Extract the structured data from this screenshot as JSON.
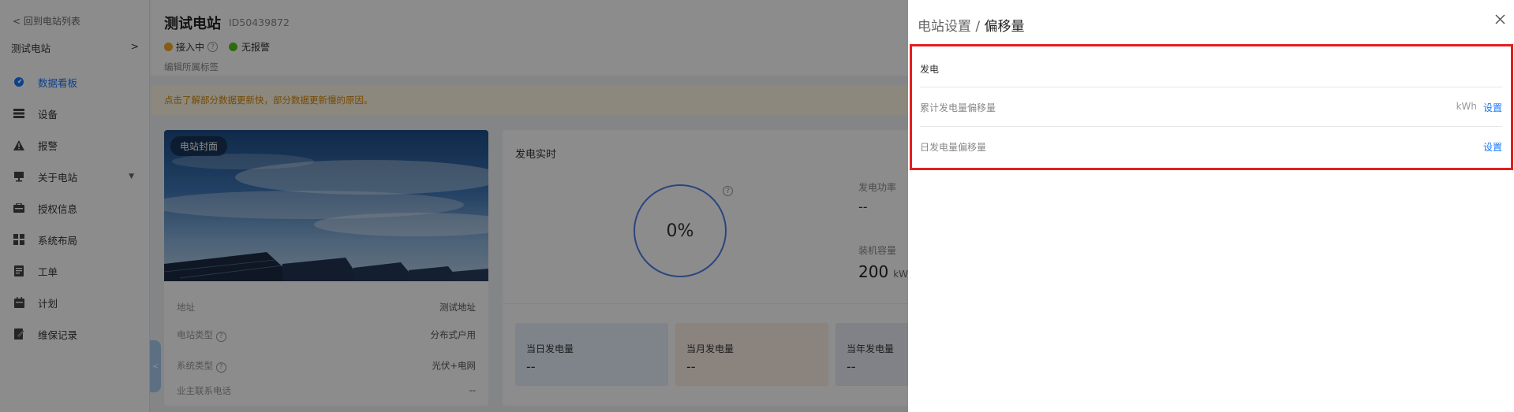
{
  "sidebar": {
    "back_label": "回到电站列表",
    "station_name": "测试电站",
    "items": [
      {
        "label": "数据看板",
        "icon": "dashboard-icon"
      },
      {
        "label": "设备",
        "icon": "device-icon"
      },
      {
        "label": "报警",
        "icon": "alarm-icon"
      },
      {
        "label": "关于电站",
        "icon": "station-info-icon"
      },
      {
        "label": "授权信息",
        "icon": "authorization-icon"
      },
      {
        "label": "系统布局",
        "icon": "layout-icon"
      },
      {
        "label": "工单",
        "icon": "work-order-icon"
      },
      {
        "label": "计划",
        "icon": "plan-icon"
      },
      {
        "label": "维保记录",
        "icon": "maintenance-icon"
      }
    ]
  },
  "header": {
    "title": "测试电站",
    "station_id": "ID50439872",
    "status_access": "接入中",
    "status_alarm": "无报警",
    "tag_edit": "编辑所属标签"
  },
  "notice": "点击了解部分数据更新快，部分数据更新慢的原因。",
  "cover": {
    "badge": "电站封面",
    "rows": [
      {
        "label": "地址",
        "value": "测试地址"
      },
      {
        "label": "电站类型",
        "value": "分布式户用"
      },
      {
        "label": "系统类型",
        "value": "光伏+电网"
      },
      {
        "label": "业主联系电话",
        "value": "--"
      }
    ]
  },
  "realtime": {
    "title": "发电实时",
    "gauge_value": "0%",
    "power_label": "发电功率",
    "power_value": "--",
    "capacity_label": "装机容量",
    "capacity_value": "200",
    "capacity_unit": "kWp",
    "stats": [
      {
        "label": "当日发电量",
        "value": "--"
      },
      {
        "label": "当月发电量",
        "value": "--"
      },
      {
        "label": "当年发电量",
        "value": "--"
      }
    ]
  },
  "drawer": {
    "breadcrumb_parent": "电站设置",
    "breadcrumb_sep": "/",
    "breadcrumb_current": "偏移量",
    "section_title": "发电",
    "rows": [
      {
        "label": "累计发电量偏移量",
        "unit": "kWh",
        "action": "设置"
      },
      {
        "label": "日发电量偏移量",
        "unit": "",
        "action": "设置"
      }
    ]
  },
  "colors": {
    "accent": "#1677ff",
    "highlight_border": "#e02020",
    "status_access": "#f5a623",
    "status_ok": "#52c41a"
  }
}
